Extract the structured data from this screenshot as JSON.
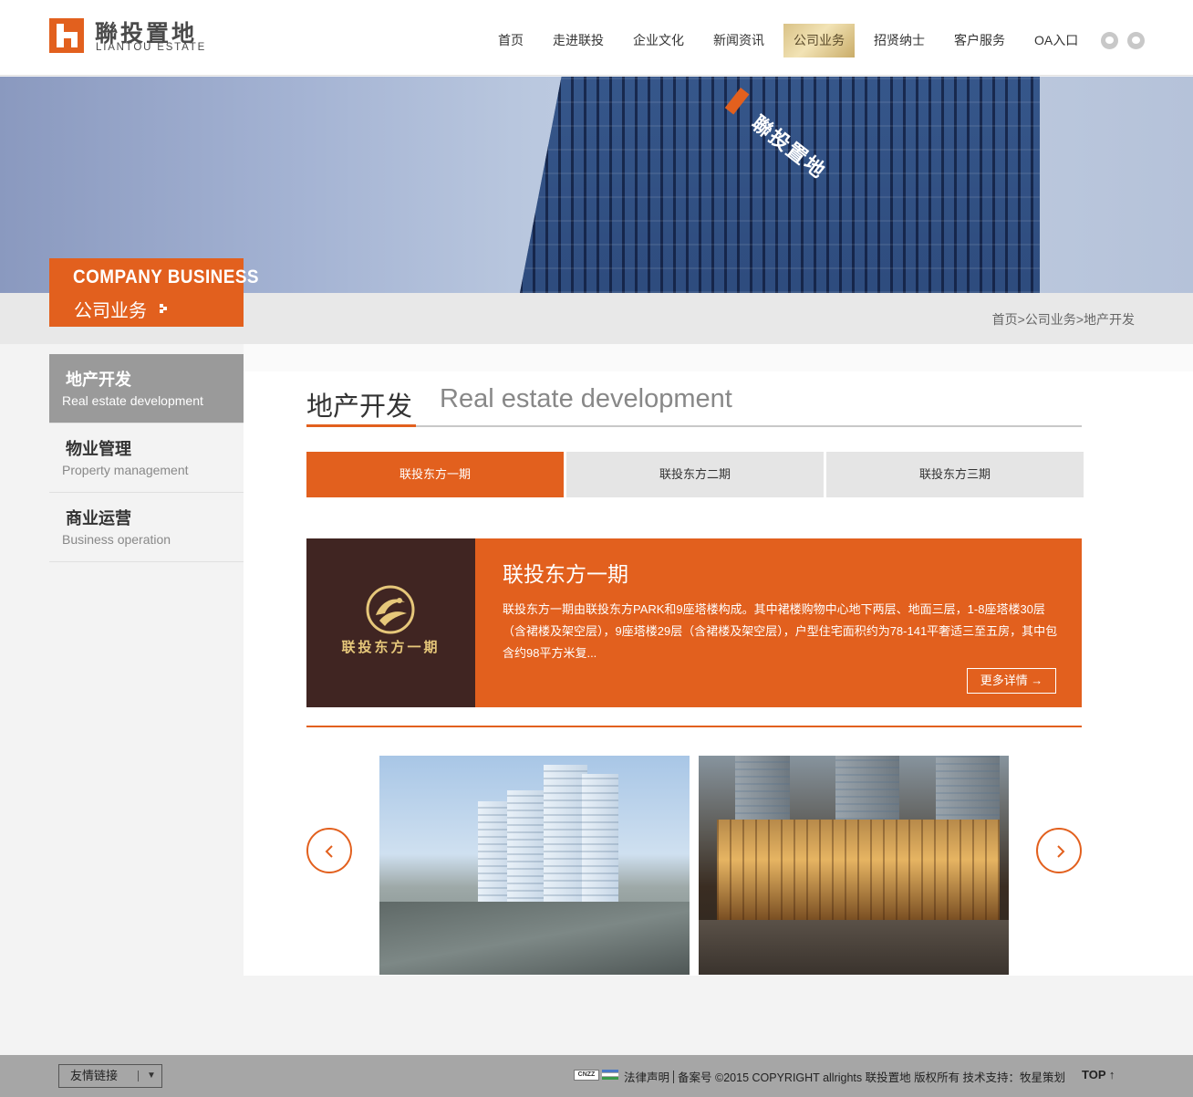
{
  "logo": {
    "cn": "聯投置地",
    "en": "LIANTOU ESTATE"
  },
  "nav": {
    "items": [
      {
        "label": "首页"
      },
      {
        "label": "走进联投"
      },
      {
        "label": "企业文化"
      },
      {
        "label": "新闻资讯"
      },
      {
        "label": "公司业务",
        "active": true
      },
      {
        "label": "招贤纳士"
      },
      {
        "label": "客户服务"
      },
      {
        "label": "OA入口"
      }
    ],
    "social_icons": [
      "wechat-icon",
      "weibo-icon"
    ]
  },
  "banner": {
    "sign": "聯投置地"
  },
  "sidebar": {
    "title_en": "COMPANY BUSINESS",
    "title_cn": "公司业务",
    "items": [
      {
        "cn": "地产开发",
        "en": "Real estate development",
        "active": true
      },
      {
        "cn": "物业管理",
        "en": "Property management"
      },
      {
        "cn": "商业运营",
        "en": "Business operation"
      }
    ]
  },
  "breadcrumb": {
    "home": "首页",
    "sep": ">",
    "section": "公司业务",
    "current": "地产开发"
  },
  "main": {
    "title_cn": "地产开发",
    "title_en": "Real estate development",
    "tabs": [
      {
        "label": "联投东方一期",
        "active": true
      },
      {
        "label": "联投东方二期"
      },
      {
        "label": "联投东方三期"
      }
    ],
    "project": {
      "logo_caption": "联投东方一期",
      "title": "联投东方一期",
      "description": "联投东方一期由联投东方PARK和9座塔楼构成。其中裙楼购物中心地下两层、地面三层，1-8座塔楼30层（含裙楼及架空层），9座塔楼29层（含裙楼及架空层），户型住宅面积约为78-141平奢适三至五房，其中包含约98平方米复...",
      "more_label": "更多详情 →"
    }
  },
  "footer": {
    "links_select": "友情链接",
    "cnzz": "CNZZ",
    "legal": "法律声明",
    "record": "备案号",
    "copyright": "©2015 COPYRIGHT allrights 联投置地 版权所有 技术支持：牧星策划",
    "top": "TOP ↑"
  },
  "colors": {
    "accent": "#e2601e",
    "dark_brown": "#402522",
    "gold": "#d9c287"
  }
}
